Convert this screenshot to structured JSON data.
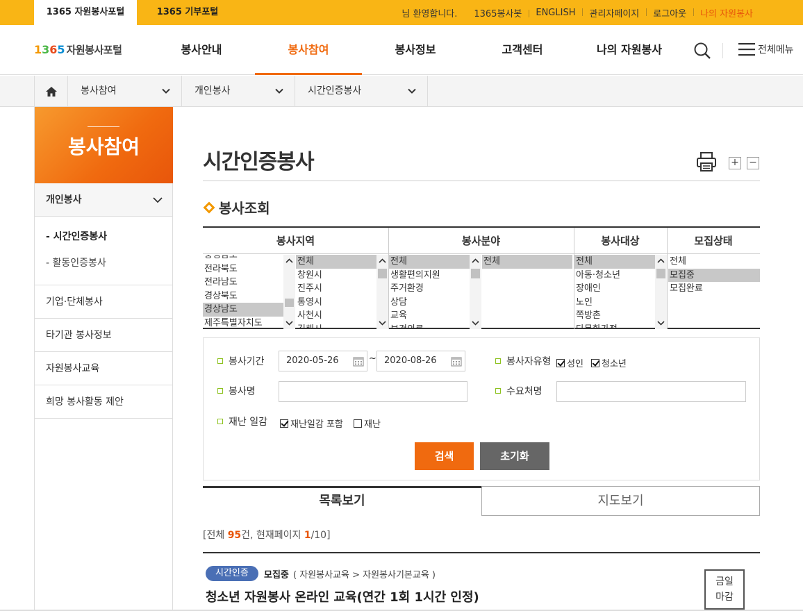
{
  "topbar": {
    "tab_portal": "1365 자원봉사포털",
    "tab_donation": "1365 기부포털",
    "welcome": "님 환영합니다.",
    "links": [
      "1365봉사봇",
      "ENGLISH",
      "관리자페이지",
      "로그아웃"
    ],
    "my_volunteer": "나의 자원봉사"
  },
  "header": {
    "logo_num": [
      "1",
      "3",
      "6",
      "5"
    ],
    "logo_text": "자원봉사포털",
    "gnb": [
      "봉사안내",
      "봉사참여",
      "봉사정보",
      "고객센터",
      "나의 자원봉사"
    ],
    "all_menu": "전체메뉴"
  },
  "breadcrumb": [
    "봉사참여",
    "개인봉사",
    "시간인증봉사"
  ],
  "lnb": {
    "title": "봉사참여",
    "section": "개인봉사",
    "sub_items": [
      "- 시간인증봉사",
      "- 활동인증봉사"
    ],
    "items": [
      "기업·단체봉사",
      "타기관 봉사정보",
      "자원봉사교육",
      "희망 봉사활동 제안"
    ]
  },
  "page": {
    "title": "시간인증봉사",
    "zoom_in": "+",
    "zoom_out": "−",
    "subtitle": "봉사조회"
  },
  "selectors": {
    "headers": [
      "봉사지역",
      "봉사분야",
      "봉사대상",
      "모집상태"
    ],
    "region": [
      "충청남도",
      "전라북도",
      "전라남도",
      "경상북도",
      "경상남도",
      "제주특별자치도"
    ],
    "city": [
      "전체",
      "창원시",
      "진주시",
      "통영시",
      "사천시",
      "김해시"
    ],
    "field": [
      "전체",
      "생활편의지원",
      "주거환경",
      "상담",
      "교육",
      "보건의료"
    ],
    "field_sub": [
      "전체"
    ],
    "target": [
      "전체",
      "아동·청소년",
      "장애인",
      "노인",
      "쪽방촌",
      "다문화가정"
    ],
    "status": [
      "전체",
      "모집중",
      "모집완료"
    ]
  },
  "form": {
    "period_label": "봉사기간",
    "date_from": "2020-05-26",
    "tilde": "~",
    "date_to": "2020-08-26",
    "type_label": "봉사자유형",
    "type_adult": "성인",
    "type_youth": "청소년",
    "name_label": "봉사명",
    "name_value": "",
    "demand_label": "수요처명",
    "demand_value": "",
    "disaster_label": "재난 일감",
    "disaster_include": "재난일감 포함",
    "disaster_only": "재난",
    "search_btn": "검색",
    "reset_btn": "초기화"
  },
  "view_tabs": [
    "목록보기",
    "지도보기"
  ],
  "count": {
    "prefix": "[전체 ",
    "total": "95",
    "mid": "건, 현재페이지 ",
    "current": "1",
    "suffix": "/10]"
  },
  "result": {
    "badge": "시간인증",
    "status": "모집중",
    "path": "( 자원봉사교육  > 자원봉사기본교육 )",
    "title": "청소년 자원봉사 온라인 교육(연간 1회 1시간 인정)",
    "deadline_line1": "금일",
    "deadline_line2": "마감"
  }
}
